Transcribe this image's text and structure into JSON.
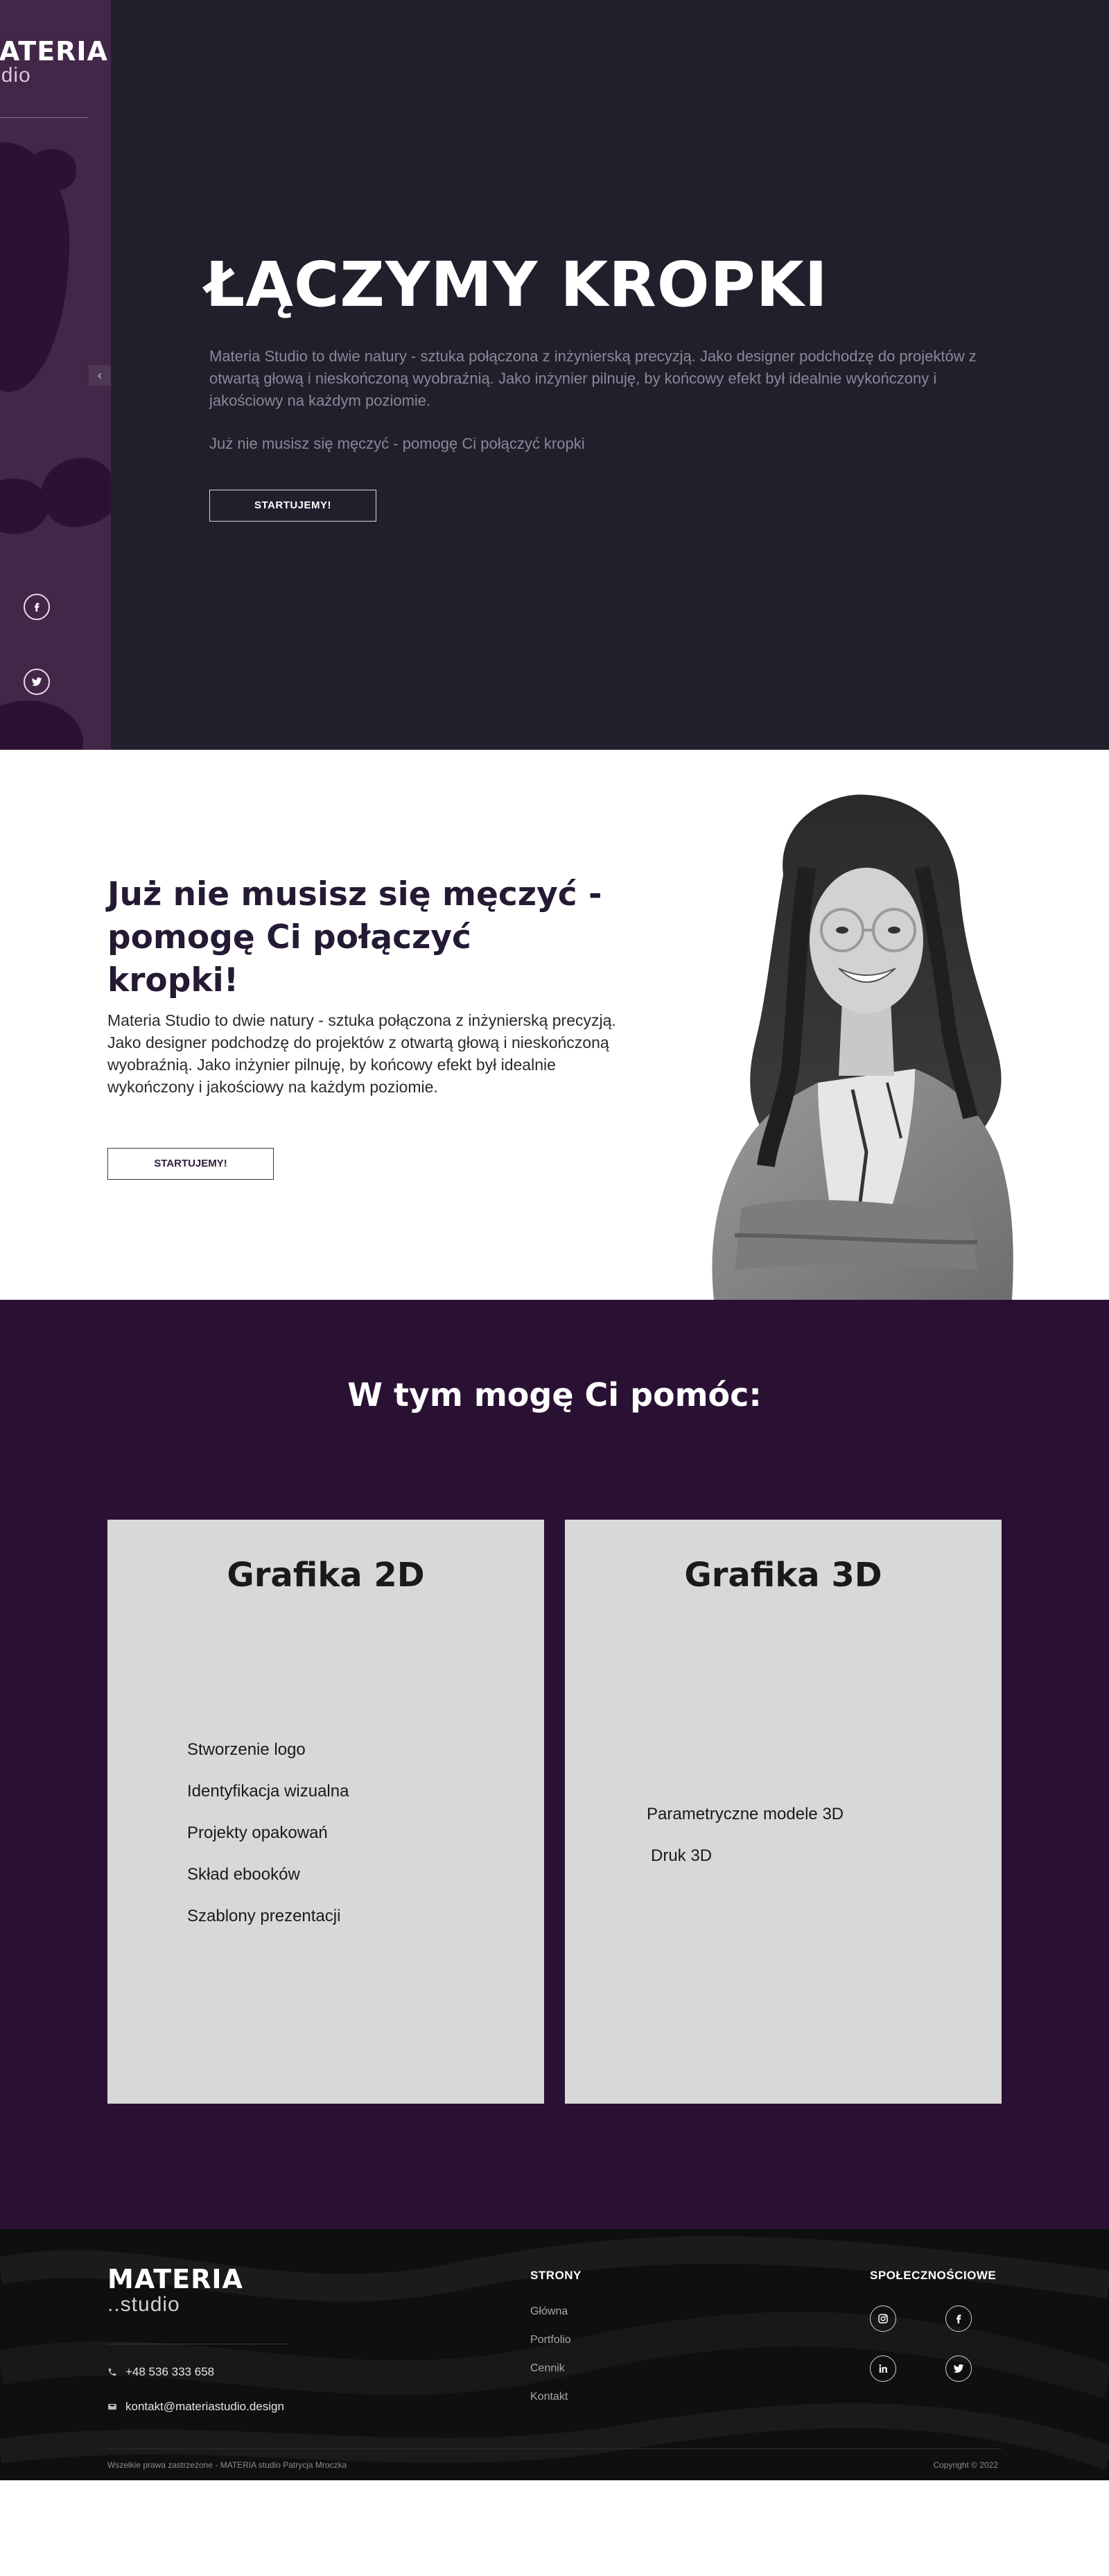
{
  "brand": {
    "logo_word": "MATERIA",
    "logo_sub": "..studio"
  },
  "sidebar": {
    "toggle_label": "‹",
    "socials": [
      "facebook-icon",
      "twitter-icon"
    ]
  },
  "hero": {
    "title": "ŁĄCZYMY KROPKI",
    "description": "Materia Studio to dwie natury - sztuka połączona z inżynierską precyzją. Jako designer podchodzę do projektów z otwartą głową i nieskończoną wyobraźnią. Jako inżynier pilnuję, by końcowy efekt był idealnie wykończony i jakościowy na każdym poziomie.",
    "tagline": "Już nie musisz się męczyć - pomogę Ci połączyć kropki",
    "button": "STARTUJEMY!"
  },
  "about": {
    "title": "Już nie musisz się męczyć - pomogę Ci połączyć kropki!",
    "description": "Materia Studio to dwie natury - sztuka połączona z inżynierską precyzją. Jako designer podchodzę do projektów z otwartą głową i nieskończoną wyobraźnią. Jako inżynier pilnuję, by końcowy efekt był idealnie wykończony i jakościowy na każdym poziomie.",
    "button": "STARTUJEMY!"
  },
  "services": {
    "title": "W tym mogę Ci pomóc:",
    "cards": [
      {
        "title": "Grafika 2D",
        "items": [
          "Stworzenie logo",
          "Identyfikacja wizualna",
          "Projekty opakowań",
          "Skład ebooków",
          "Szablony prezentacji"
        ]
      },
      {
        "title": "Grafika 3D",
        "items": [
          "Parametryczne modele 3D",
          "Druk 3D"
        ]
      }
    ]
  },
  "footer": {
    "logo_word": "MATERIA",
    "logo_sub": "..studio",
    "phone": "+48 536 333 658",
    "email": "kontakt@materiastudio.design",
    "pages_heading": "STRONY",
    "pages": [
      "Główna",
      "Portfolio",
      "Cennik",
      "Kontakt"
    ],
    "social_heading": "SPOŁECZNOŚCIOWE",
    "socials": [
      "instagram-icon",
      "facebook-icon",
      "linkedin-icon",
      "twitter-icon"
    ],
    "copyright_left": "Wszelkie prawa zastrzeżone - MATERIA studio Patrycja Mroczka",
    "copyright_right": "Copyright © 2022"
  },
  "colors": {
    "hero_bg": "#20202d",
    "sidebar_bg": "#422748",
    "services_bg": "#2a1134",
    "card_bg": "#d8d8d8",
    "footer_bg": "#0f0f10"
  }
}
